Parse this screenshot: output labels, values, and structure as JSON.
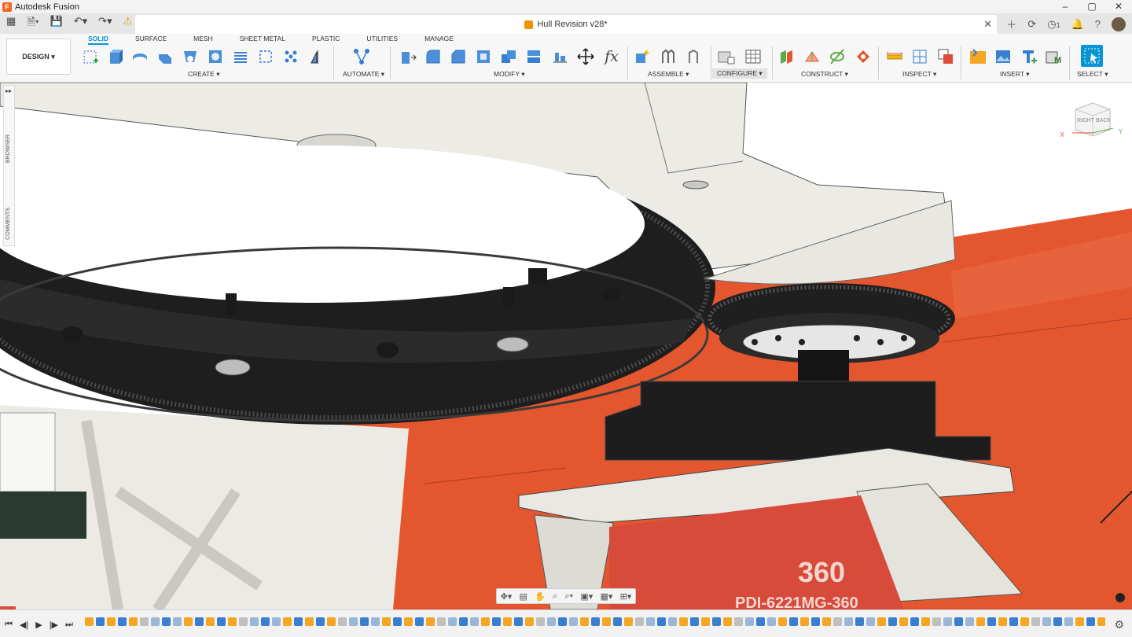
{
  "window": {
    "title": "Autodesk Fusion",
    "controls": [
      "–",
      "▢",
      "✕"
    ]
  },
  "document": {
    "title": "Hull Revision v28*"
  },
  "notifications": {
    "job_count": "1"
  },
  "workspace": {
    "label": "DESIGN ▾"
  },
  "tabs": [
    "SOLID",
    "SURFACE",
    "MESH",
    "SHEET METAL",
    "PLASTIC",
    "UTILITIES",
    "MANAGE"
  ],
  "groups": {
    "create": "CREATE ▾",
    "automate": "AUTOMATE ▾",
    "modify": "MODIFY ▾",
    "assemble": "ASSEMBLE ▾",
    "configure": "CONFIGURE ▾",
    "construct": "CONSTRUCT ▾",
    "inspect": "INSPECT ▾",
    "insert": "INSERT ▾",
    "select": "SELECT ▾"
  },
  "side_panel": {
    "browser": "BROWSER",
    "comments": "COMMENTS"
  },
  "viewcube": {
    "right": "RIGHT",
    "back": "BACK",
    "x": "X",
    "y": "Y"
  },
  "model_text": {
    "brand": "360",
    "part": "PDI-6221MG-360"
  },
  "colors": {
    "accent": "#0696d7",
    "model_orange": "#e4572e",
    "model_white": "#ecebe6",
    "model_dark": "#2b2b2b"
  }
}
